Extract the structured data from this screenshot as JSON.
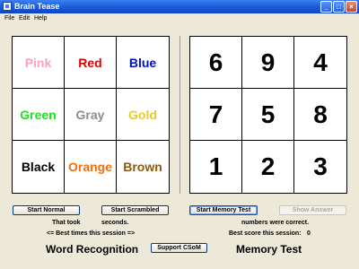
{
  "window": {
    "title": "Brain Tease"
  },
  "menu": [
    "File",
    "Edit",
    "Help"
  ],
  "word_grid": [
    {
      "text": "Pink",
      "color": "#f5a3c0"
    },
    {
      "text": "Red",
      "color": "#e00000"
    },
    {
      "text": "Blue",
      "color": "#0010c8"
    },
    {
      "text": "Green",
      "color": "#22e022"
    },
    {
      "text": "Gray",
      "color": "#8c8c8c"
    },
    {
      "text": "Gold",
      "color": "#e8c830"
    },
    {
      "text": "Black",
      "color": "#000000"
    },
    {
      "text": "Orange",
      "color": "#f07010"
    },
    {
      "text": "Brown",
      "color": "#8a5a10"
    }
  ],
  "number_grid": [
    "6",
    "9",
    "4",
    "7",
    "5",
    "8",
    "1",
    "2",
    "3"
  ],
  "left": {
    "start_normal": "Start Normal",
    "start_scrambled": "Start Scrambled",
    "that_took": "That took",
    "seconds": "seconds.",
    "best_times": "<= Best times this session =>",
    "title": "Word Recognition"
  },
  "right": {
    "start_memory": "Start Memory Test",
    "show_answer": "Show Answer",
    "numbers_correct": "numbers were correct.",
    "best_score_label": "Best score this session:",
    "best_score_value": "0",
    "title": "Memory Test"
  },
  "support_button": "Support CSoM"
}
